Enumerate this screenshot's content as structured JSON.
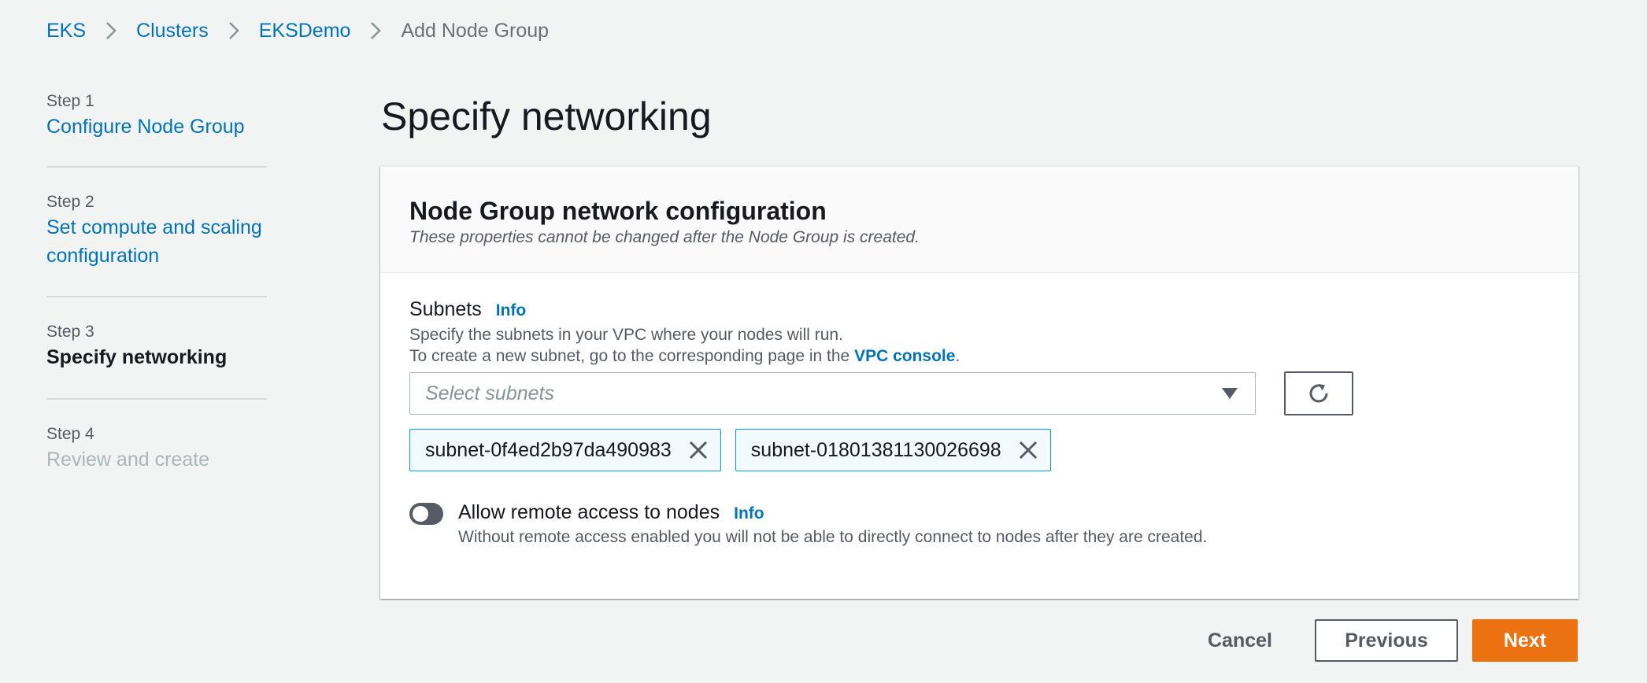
{
  "breadcrumb": {
    "items": [
      "EKS",
      "Clusters",
      "EKSDemo"
    ],
    "current": "Add Node Group"
  },
  "steps": [
    {
      "label": "Step 1",
      "title": "Configure Node Group",
      "state": "link"
    },
    {
      "label": "Step 2",
      "title": "Set compute and scaling configuration",
      "state": "link"
    },
    {
      "label": "Step 3",
      "title": "Specify networking",
      "state": "current"
    },
    {
      "label": "Step 4",
      "title": "Review and create",
      "state": "disabled"
    }
  ],
  "page": {
    "title": "Specify networking"
  },
  "panel": {
    "title": "Node Group network configuration",
    "description": "These properties cannot be changed after the Node Group is created."
  },
  "subnets": {
    "label": "Subnets",
    "info": "Info",
    "desc_line1": "Specify the subnets in your VPC where your nodes will run.",
    "desc_line2_prefix": "To create a new subnet, go to the corresponding page in the ",
    "desc_link": "VPC console",
    "desc_line2_suffix": ".",
    "placeholder": "Select subnets",
    "selected": [
      "subnet-0f4ed2b97da490983",
      "subnet-01801381130026698"
    ]
  },
  "remote_access": {
    "label": "Allow remote access to nodes",
    "info": "Info",
    "description": "Without remote access enabled you will not be able to directly connect to nodes after they are created.",
    "enabled": false
  },
  "footer": {
    "cancel": "Cancel",
    "previous": "Previous",
    "next": "Next"
  },
  "colors": {
    "link": "#0073bb",
    "primary_button": "#ec7211",
    "background": "#f2f3f3",
    "token_border": "#00a1c9"
  }
}
